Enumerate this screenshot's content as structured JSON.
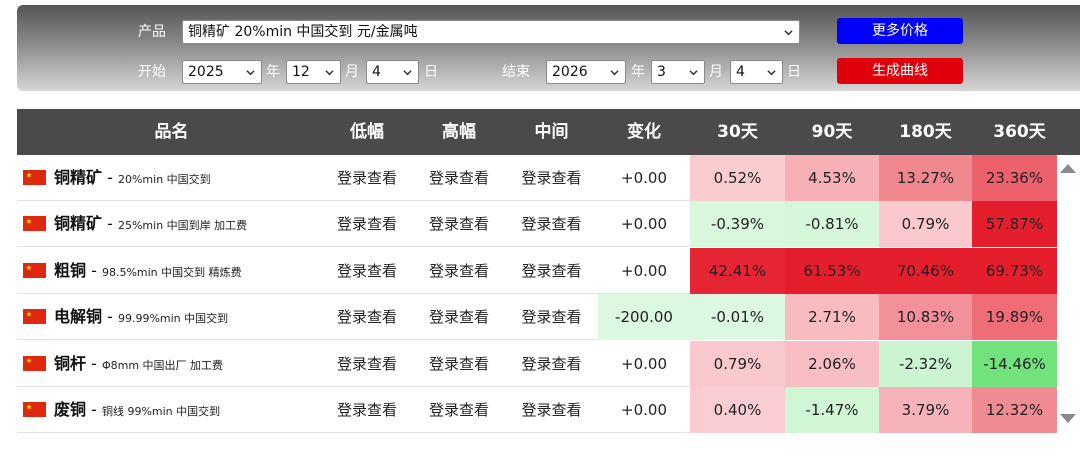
{
  "filters": {
    "product_label": "产品",
    "product_value": "铜精矿 20%min 中国交到 元/金属吨",
    "start_label": "开始",
    "end_label": "结束",
    "year_unit": "年",
    "month_unit": "月",
    "day_unit": "日",
    "start_year": "2025",
    "start_month": "12",
    "start_day": "4",
    "end_year": "2026",
    "end_month": "3",
    "end_day": "4",
    "more_price_btn": "更多价格",
    "generate_curve_btn": "生成曲线"
  },
  "colors": {
    "more_price_btn": "#0000ff",
    "generate_curve_btn": "#e0000c",
    "header_bg": "#4a4a4a"
  },
  "table": {
    "headers": [
      "品名",
      "低幅",
      "高幅",
      "中间",
      "变化",
      "30天",
      "90天",
      "180天",
      "360天"
    ],
    "rows": [
      {
        "name": "铜精矿",
        "desc": "20%min 中国交到",
        "low": "登录查看",
        "high": "登录查看",
        "mid": "登录查看",
        "change": "+0.00",
        "d30": "0.52%",
        "d90": "4.53%",
        "d180": "13.27%",
        "d360": "23.36%"
      },
      {
        "name": "铜精矿",
        "desc": "25%min 中国到岸 加工费",
        "low": "登录查看",
        "high": "登录查看",
        "mid": "登录查看",
        "change": "+0.00",
        "d30": "-0.39%",
        "d90": "-0.81%",
        "d180": "0.79%",
        "d360": "57.87%"
      },
      {
        "name": "粗铜",
        "desc": "98.5%min 中国交到 精炼费",
        "low": "登录查看",
        "high": "登录查看",
        "mid": "登录查看",
        "change": "+0.00",
        "d30": "42.41%",
        "d90": "61.53%",
        "d180": "70.46%",
        "d360": "69.73%"
      },
      {
        "name": "电解铜",
        "desc": "99.99%min 中国交到",
        "low": "登录查看",
        "high": "登录查看",
        "mid": "登录查看",
        "change": "-200.00",
        "d30": "-0.01%",
        "d90": "2.71%",
        "d180": "10.83%",
        "d360": "19.89%"
      },
      {
        "name": "铜杆",
        "desc": "Φ8mm 中国出厂 加工费",
        "low": "登录查看",
        "high": "登录查看",
        "mid": "登录查看",
        "change": "+0.00",
        "d30": "0.79%",
        "d90": "2.06%",
        "d180": "-2.32%",
        "d360": "-14.46%"
      },
      {
        "name": "废铜",
        "desc": "铜线 99%min 中国交到",
        "low": "登录查看",
        "high": "登录查看",
        "mid": "登录查看",
        "change": "+0.00",
        "d30": "0.40%",
        "d90": "-1.47%",
        "d180": "3.79%",
        "d360": "12.32%"
      }
    ]
  }
}
